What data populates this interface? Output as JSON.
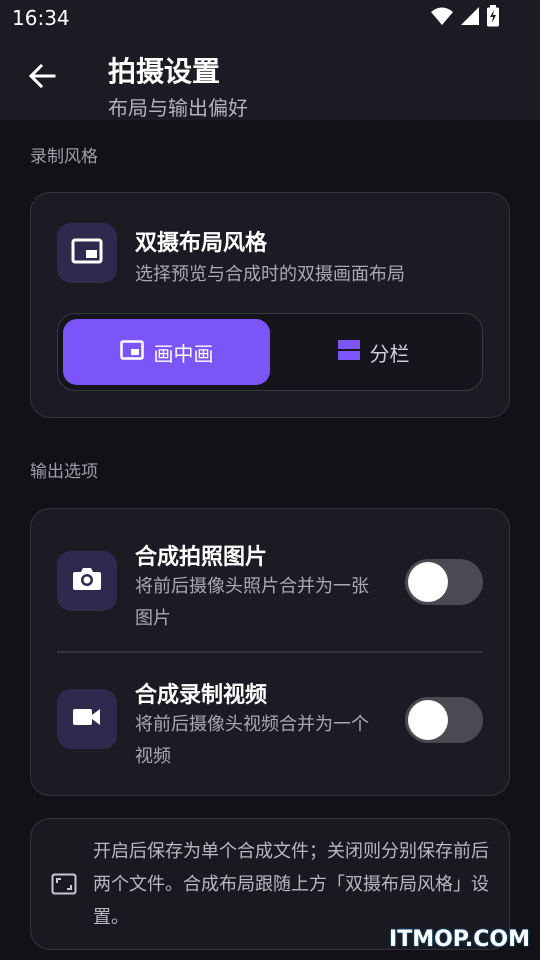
{
  "status": {
    "time": "16:34",
    "icons": [
      "wifi-icon",
      "signal-icon",
      "battery-icon"
    ]
  },
  "appbar": {
    "title": "拍摄设置",
    "subtitle": "布局与输出偏好",
    "back_icon": "arrow-left-icon"
  },
  "recording_style": {
    "section_label": "录制风格",
    "card": {
      "icon": "picture-in-picture-icon",
      "title": "双摄布局风格",
      "description": "选择预览与合成时的双摄画面布局",
      "options": [
        {
          "label": "画中画",
          "icon": "picture-in-picture-icon",
          "selected": true
        },
        {
          "label": "分栏",
          "icon": "split-view-icon",
          "selected": false
        }
      ]
    }
  },
  "output_options": {
    "section_label": "输出选项",
    "items": [
      {
        "icon": "camera-icon",
        "title": "合成拍照图片",
        "description": "将前后摄像头照片合并为一张图片",
        "enabled": false
      },
      {
        "icon": "video-camera-icon",
        "title": "合成录制视频",
        "description": "将前后摄像头视频合并为一个视频",
        "enabled": false
      }
    ]
  },
  "info": {
    "icon": "aspect-ratio-icon",
    "text": "开启后保存为单个合成文件；关闭则分别保存前后两个文件。合成布局跟随上方「双摄布局风格」设置。"
  },
  "watermark": "ITMOP.COM",
  "colors": {
    "accent": "#7b55f7",
    "background": "#121116",
    "card": "#1c1b23",
    "icon_tile": "#2f2a4d"
  }
}
